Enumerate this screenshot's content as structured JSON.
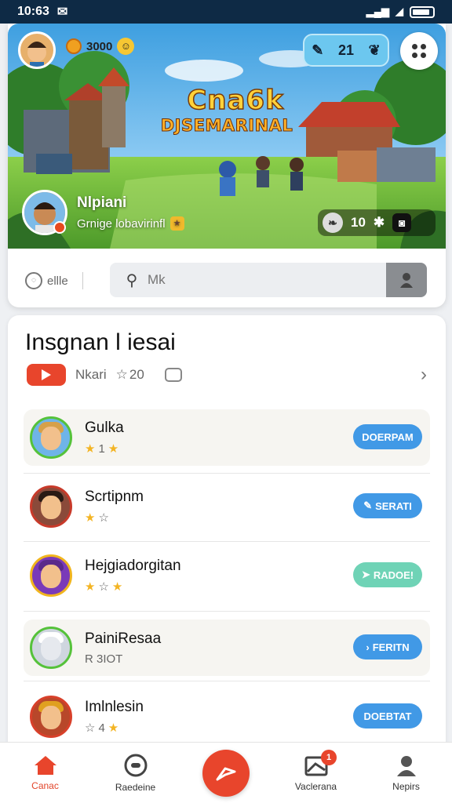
{
  "status_bar": {
    "time": "10:63"
  },
  "header": {
    "coins": "3000",
    "gems": "21",
    "game_title_line1": "Cna6k",
    "game_title_line2": "DJSEMARINAL",
    "player_name": "Nlpiani",
    "player_subtitle": "Grnige lobavirinfl",
    "stat_value": "10"
  },
  "search": {
    "filter_label": "ellle",
    "placeholder": "Mk"
  },
  "list": {
    "title": "Insgnan l iesai",
    "meta_label": "Nkari",
    "meta_rating": "20",
    "rows": [
      {
        "name": "Gulka",
        "rating": "1",
        "action": "DOERPAM",
        "action_color": "#4199e6"
      },
      {
        "name": "Scrtipnm",
        "rating": "",
        "action": "SERATI",
        "action_color": "#4199e6"
      },
      {
        "name": "Hejgiadorgitan",
        "rating": "",
        "action": "RADOE!",
        "action_color": "#6fd3b6"
      },
      {
        "name": "PainiResaa",
        "rating": "R 3IOT",
        "action": "FERITN",
        "action_color": "#4199e6"
      },
      {
        "name": "Imlnlesin",
        "rating": "4",
        "action": "DOEBTAT",
        "action_color": "#4199e6"
      }
    ]
  },
  "bottom_nav": {
    "items": [
      "Canac",
      "Raedeine",
      "",
      "Vaclerana",
      "Nepirs"
    ],
    "badge": "1"
  },
  "colors": {
    "accent": "#e8452c",
    "primary_button": "#4199e6",
    "status_bar": "#0e2a45"
  }
}
